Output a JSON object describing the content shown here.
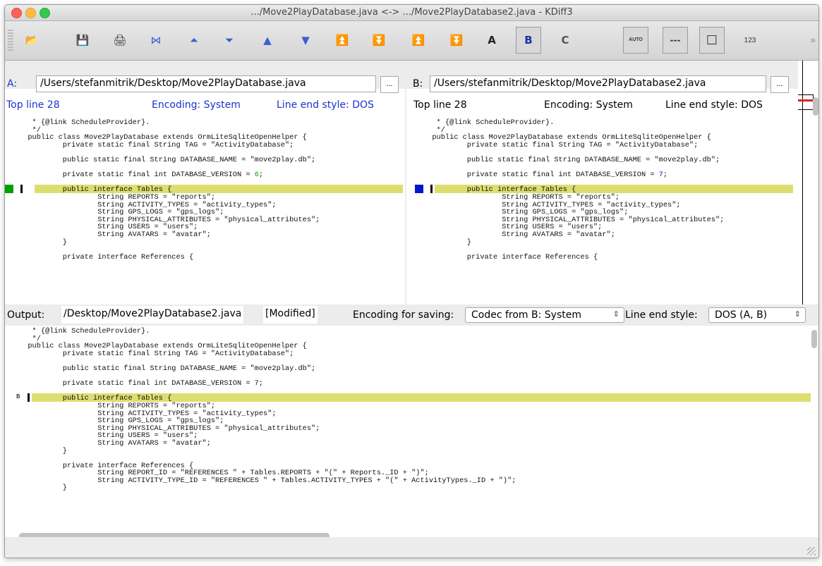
{
  "window": {
    "title": ".../Move2PlayDatabase.java <-> .../Move2PlayDatabase2.java - KDiff3"
  },
  "toolbar": {
    "buttons": [
      {
        "name": "open-icon",
        "glyph": "📂"
      },
      {
        "name": "save-icon",
        "glyph": "💾"
      },
      {
        "name": "print-icon",
        "glyph": "🖨"
      },
      {
        "name": "go-current-delta-icon",
        "glyph": "⋈"
      },
      {
        "name": "go-top-icon",
        "glyph": "⏶"
      },
      {
        "name": "go-bottom-icon",
        "glyph": "⏷"
      },
      {
        "name": "go-prev-delta-icon",
        "glyph": "▲"
      },
      {
        "name": "go-next-delta-icon",
        "glyph": "▼"
      },
      {
        "name": "go-prev-conflict-icon",
        "glyph": "⏫"
      },
      {
        "name": "go-next-conflict-icon",
        "glyph": "⏬"
      },
      {
        "name": "go-prev-unsolved-icon",
        "glyph": "⏫"
      },
      {
        "name": "go-next-unsolved-icon",
        "glyph": "⏬"
      },
      {
        "name": "select-a-icon",
        "glyph": "A"
      },
      {
        "name": "select-b-icon",
        "glyph": "B"
      },
      {
        "name": "select-c-icon",
        "glyph": "C"
      },
      {
        "name": "auto-advance-icon",
        "glyph": "AUTO"
      },
      {
        "name": "show-whitespace-icon",
        "glyph": "---"
      },
      {
        "name": "show-whitespace-chars-icon",
        "glyph": "☐"
      },
      {
        "name": "show-line-numbers-icon",
        "glyph": "123"
      }
    ],
    "overflow": "»"
  },
  "paneA": {
    "label": "A:",
    "path": "/Users/stefanmitrik/Desktop/Move2PlayDatabase.java",
    "browse": "...",
    "top_line": "Top line 28",
    "encoding": "Encoding: System",
    "line_end": "Line end style: DOS",
    "code": [
      "   * {@link ScheduleProvider}.",
      "   */",
      "  public class Move2PlayDatabase extends OrmLiteSqliteOpenHelper {",
      "          private static final String TAG = \"ActivityDatabase\";",
      "",
      "          public static final String DATABASE_NAME = \"move2play.db\";",
      "",
      "          private static final int DATABASE_VERSION = 6;",
      "",
      "          public interface Tables {",
      "                  String REPORTS = \"reports\";",
      "                  String ACTIVITY_TYPES = \"activity_types\";",
      "                  String GPS_LOGS = \"gps_logs\";",
      "                  String PHYSICAL_ATTRIBUTES = \"physical_attributes\";",
      "                  String USERS = \"users\";",
      "                  String AVATARS = \"avatar\";",
      "          }",
      "",
      "          private interface References {"
    ]
  },
  "paneB": {
    "label": "B:",
    "path": "/Users/stefanmitrik/Desktop/Move2PlayDatabase2.java",
    "browse": "...",
    "top_line": "Top line 28",
    "encoding": "Encoding: System",
    "line_end": "Line end style: DOS",
    "code": [
      "   * {@link ScheduleProvider}.",
      "   */",
      "  public class Move2PlayDatabase extends OrmLiteSqliteOpenHelper {",
      "          private static final String TAG = \"ActivityDatabase\";",
      "",
      "          public static final String DATABASE_NAME = \"move2play.db\";",
      "",
      "          private static final int DATABASE_VERSION = 7;",
      "",
      "          public interface Tables {",
      "                  String REPORTS = \"reports\";",
      "                  String ACTIVITY_TYPES = \"activity_types\";",
      "                  String GPS_LOGS = \"gps_logs\";",
      "                  String PHYSICAL_ATTRIBUTES = \"physical_attributes\";",
      "                  String USERS = \"users\";",
      "                  String AVATARS = \"avatar\";",
      "          }",
      "",
      "          private interface References {"
    ]
  },
  "output": {
    "label": "Output:",
    "path": "/Desktop/Move2PlayDatabase2.java",
    "modified": "[Modified]",
    "encoding_label": "Encoding for saving:",
    "encoding_value": "Codec from B: System",
    "line_end_label": "Line end style:",
    "line_end_value": "DOS (A, B)",
    "source_marker": "B",
    "code": [
      "   * {@link ScheduleProvider}.",
      "   */",
      "  public class Move2PlayDatabase extends OrmLiteSqliteOpenHelper {",
      "          private static final String TAG = \"ActivityDatabase\";",
      "",
      "          public static final String DATABASE_NAME = \"move2play.db\";",
      "",
      "          private static final int DATABASE_VERSION = 7;",
      "",
      "          public interface Tables {",
      "                  String REPORTS = \"reports\";",
      "                  String ACTIVITY_TYPES = \"activity_types\";",
      "                  String GPS_LOGS = \"gps_logs\";",
      "                  String PHYSICAL_ATTRIBUTES = \"physical_attributes\";",
      "                  String USERS = \"users\";",
      "                  String AVATARS = \"avatar\";",
      "          }",
      "",
      "          private interface References {",
      "                  String REPORT_ID = \"REFERENCES \" + Tables.REPORTS + \"(\" + Reports._ID + \")\";",
      "                  String ACTIVITY_TYPE_ID = \"REFERENCES \" + Tables.ACTIVITY_TYPES + \"(\" + ActivityTypes._ID + \")\";",
      "          }"
    ]
  },
  "colors": {
    "diff_highlight": "#dede70",
    "marker_a": "#00a000",
    "marker_b": "#0018c8",
    "info_text_a": "#1a33cc"
  }
}
